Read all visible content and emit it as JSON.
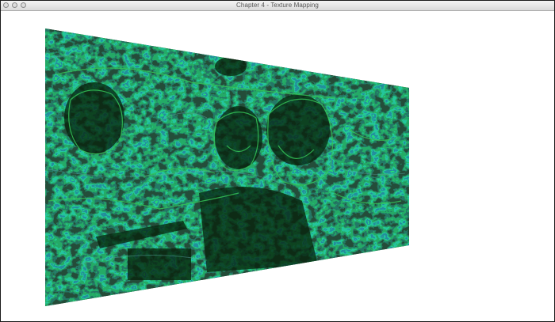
{
  "window": {
    "title": "Chapter 4 - Texture Mapping",
    "controls": [
      "close-button",
      "minimize-button",
      "zoom-button"
    ]
  },
  "render": {
    "description_colors": {
      "background": "#ffffff",
      "edge_dark": "#0a2a0a",
      "edge_green": "#1f8f3a",
      "edge_teal": "#3a6e6e",
      "edge_bright": "#3ccf5a"
    }
  }
}
